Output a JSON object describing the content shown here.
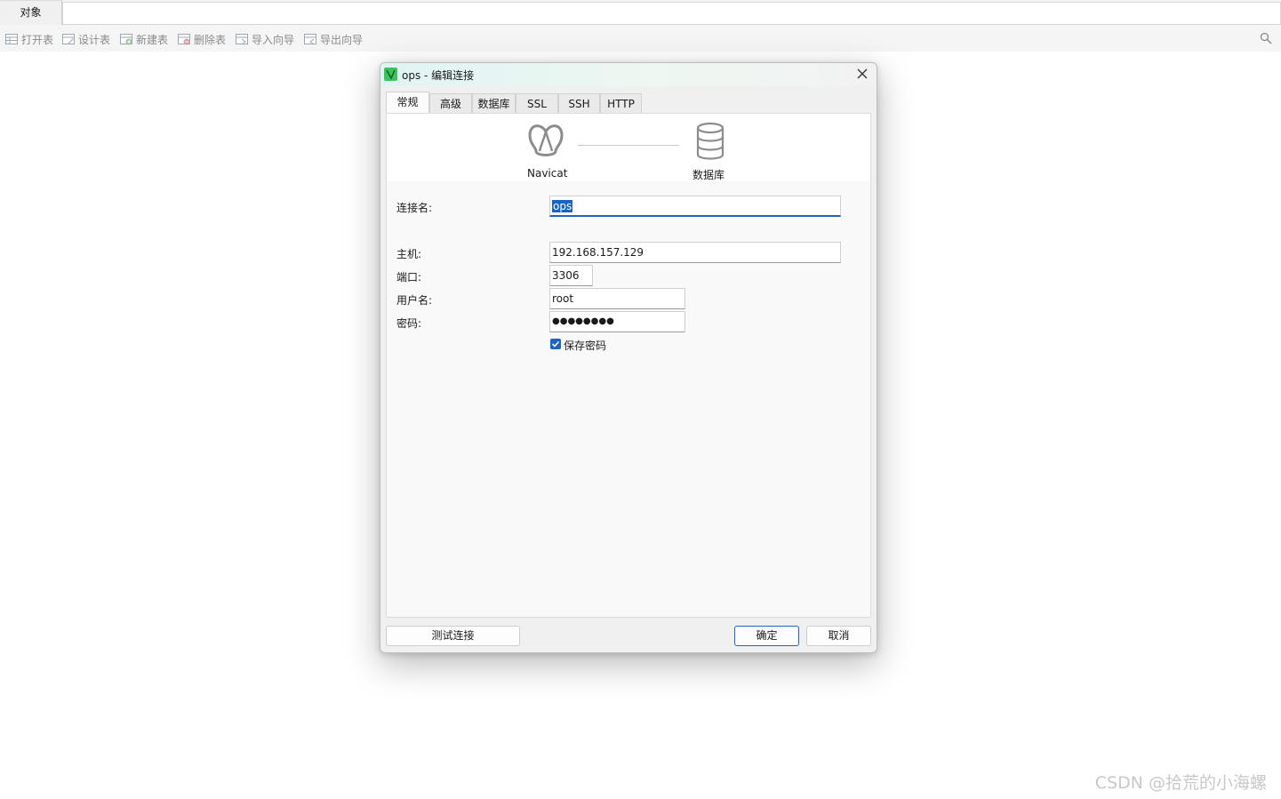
{
  "top_tabs": {
    "objects": "对象"
  },
  "toolbar": {
    "items": [
      {
        "label": "打开表",
        "icon": "open-table-icon"
      },
      {
        "label": "设计表",
        "icon": "design-table-icon"
      },
      {
        "label": "新建表",
        "icon": "new-table-icon"
      },
      {
        "label": "删除表",
        "icon": "delete-table-icon"
      },
      {
        "label": "导入向导",
        "icon": "import-wizard-icon"
      },
      {
        "label": "导出向导",
        "icon": "export-wizard-icon"
      }
    ],
    "search_icon": "search-icon"
  },
  "dialog": {
    "title": "ops - 编辑连接",
    "tabs": [
      "常规",
      "高级",
      "数据库",
      "SSL",
      "SSH",
      "HTTP"
    ],
    "active_tab": "常规",
    "hero": {
      "left_label": "Navicat",
      "right_label": "数据库"
    },
    "fields": {
      "connection_name": {
        "label": "连接名:",
        "value": "ops"
      },
      "host": {
        "label": "主机:",
        "value": "192.168.157.129"
      },
      "port": {
        "label": "端口:",
        "value": "3306"
      },
      "username": {
        "label": "用户名:",
        "value": "root"
      },
      "password": {
        "label": "密码:",
        "value": "●●●●●●●●"
      }
    },
    "save_password": {
      "label": "保存密码",
      "checked": true
    },
    "buttons": {
      "test": "测试连接",
      "ok": "确定",
      "cancel": "取消"
    }
  },
  "watermark": "CSDN @拾荒的小海螺",
  "colors": {
    "accent": "#1b64c4",
    "title_gradient_start": "#e0f4f4"
  }
}
